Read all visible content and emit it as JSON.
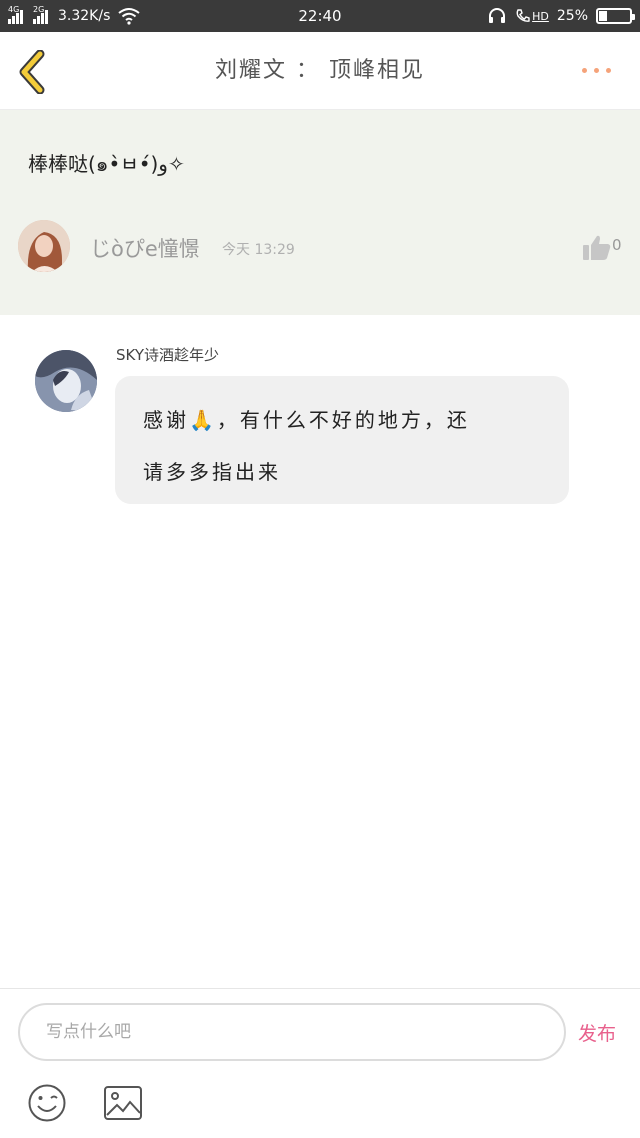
{
  "status_bar": {
    "net1": "4G",
    "net2": "2G",
    "speed": "3.32K/s",
    "time": "22:40",
    "hd": "HD",
    "battery": "25%",
    "battery_level": 0.25
  },
  "header": {
    "title": "刘耀文 ： 顶峰相见",
    "back_icon": "chevron-left-icon",
    "more_icon": "more-dots-icon",
    "accent": "#f5a37a",
    "back_color": "#f3cc3a"
  },
  "post": {
    "text": "棒棒哒(๑•̀ㅂ•́)و✧",
    "username": "じòぴe憧憬",
    "time": "今天 13:29",
    "like_count": "0"
  },
  "comment": {
    "username": "SKY诗酒趁年少",
    "line1": "感谢🙏，有什么不好的地方，还",
    "line2": "请多多指出来"
  },
  "composer": {
    "placeholder": "写点什么吧",
    "publish_label": "发布",
    "publish_color": "#e8608c"
  }
}
